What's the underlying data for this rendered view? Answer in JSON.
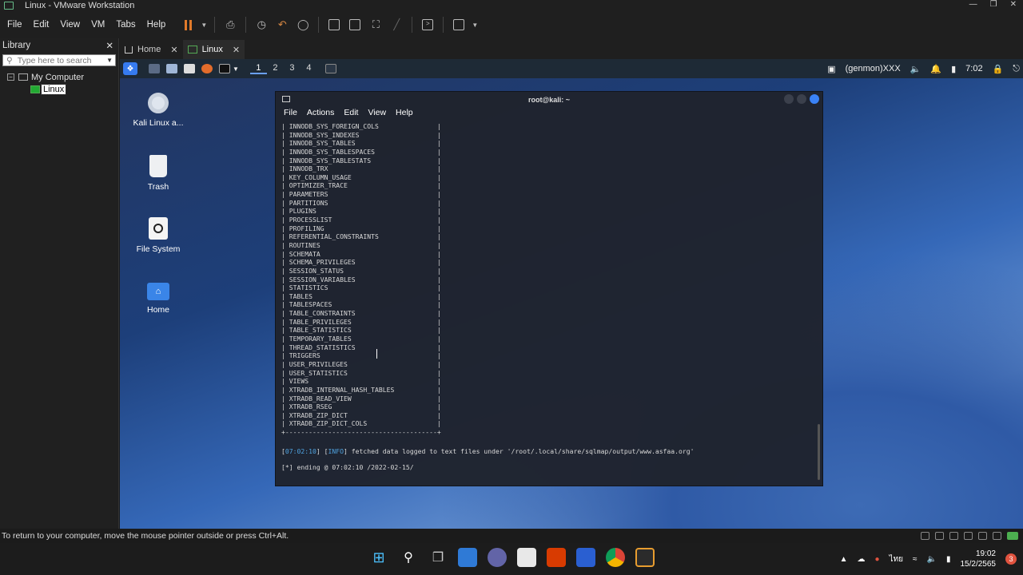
{
  "window": {
    "title": "Linux - VMware Workstation"
  },
  "menu": [
    "File",
    "Edit",
    "View",
    "VM",
    "Tabs",
    "Help"
  ],
  "library": {
    "title": "Library",
    "search_placeholder": "Type here to search",
    "tree": {
      "root": "My Computer",
      "child": "Linux"
    }
  },
  "tabs": [
    {
      "label": "Home"
    },
    {
      "label": "Linux"
    }
  ],
  "guest": {
    "workspaces": [
      "1",
      "2",
      "3",
      "4"
    ],
    "panel_user": "(genmon)XXX",
    "panel_time": "7:02",
    "desktop_icons": [
      "Kali Linux a...",
      "Trash",
      "File System",
      "Home"
    ]
  },
  "terminal": {
    "title": "root@kali: ~",
    "menu": [
      "File",
      "Actions",
      "Edit",
      "View",
      "Help"
    ],
    "tables": [
      "INNODB_SYS_FOREIGN_COLS",
      "INNODB_SYS_INDEXES",
      "INNODB_SYS_TABLES",
      "INNODB_SYS_TABLESPACES",
      "INNODB_SYS_TABLESTATS",
      "INNODB_TRX",
      "KEY_COLUMN_USAGE",
      "OPTIMIZER_TRACE",
      "PARAMETERS",
      "PARTITIONS",
      "PLUGINS",
      "PROCESSLIST",
      "PROFILING",
      "REFERENTIAL_CONSTRAINTS",
      "ROUTINES",
      "SCHEMATA",
      "SCHEMA_PRIVILEGES",
      "SESSION_STATUS",
      "SESSION_VARIABLES",
      "STATISTICS",
      "TABLES",
      "TABLESPACES",
      "TABLE_CONSTRAINTS",
      "TABLE_PRIVILEGES",
      "TABLE_STATISTICS",
      "TEMPORARY_TABLES",
      "THREAD_STATISTICS",
      "TRIGGERS",
      "USER_PRIVILEGES",
      "USER_STATISTICS",
      "VIEWS",
      "XTRADB_INTERNAL_HASH_TABLES",
      "XTRADB_READ_VIEW",
      "XTRADB_RSEG",
      "XTRADB_ZIP_DICT",
      "XTRADB_ZIP_DICT_COLS"
    ],
    "log_time": "07:02:10",
    "log_level": "INFO",
    "log_message": "fetched data logged to text files under '/root/.local/share/sqlmap/output/www.asfaa.org'",
    "ending_line": "[*] ending @ 07:02:10 /2022-02-15/"
  },
  "status": {
    "message": "To return to your computer, move the mouse pointer outside or press Ctrl+Alt."
  },
  "taskbar": {
    "lang": "ไทย",
    "time": "19:02",
    "date": "15/2/2565",
    "notifications": "3"
  }
}
